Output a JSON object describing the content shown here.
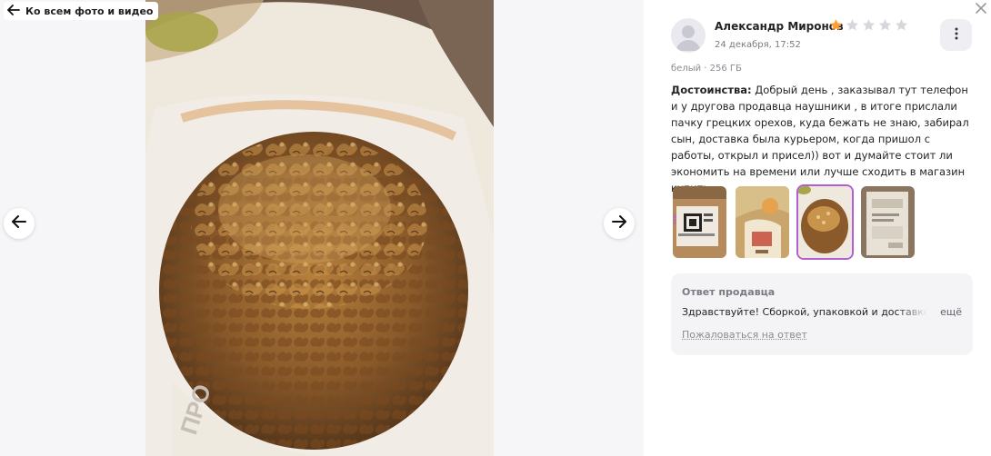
{
  "viewer": {
    "back_label": "Ко всем фото и видео",
    "icons": {
      "back": "arrow-left-icon",
      "prev": "arrow-left-icon",
      "next": "arrow-right-icon"
    }
  },
  "review": {
    "author": "Александр Миронов",
    "date": "24 декабря, 17:52",
    "rating": 1,
    "rating_max": 5,
    "variant": "белый · 256 ГБ",
    "pros_label": "Достоинства:",
    "pros_text": " Добрый день , заказывал тут телефон и у другова продавца наушники , в итоге прислали пачку грецких орехов, куда бежать не знаю, забирал сын, доставка была курьером, когда пришол с работы, открыл и присел)) вот и думайте стоит ли экономить на времени или лучше сходить в магазин купить",
    "thumbnails_count": 4,
    "active_thumbnail": 3
  },
  "reply": {
    "title": "Ответ продавца",
    "text": "Здравствуйте! Сборкой, упаковкой и доставкой",
    "more": "ещё",
    "complain": "Пожаловаться на ответ"
  },
  "colors": {
    "star_filled": "#ff9d2f",
    "star_empty": "#d6d6dc",
    "active_border": "#b15fd0"
  }
}
